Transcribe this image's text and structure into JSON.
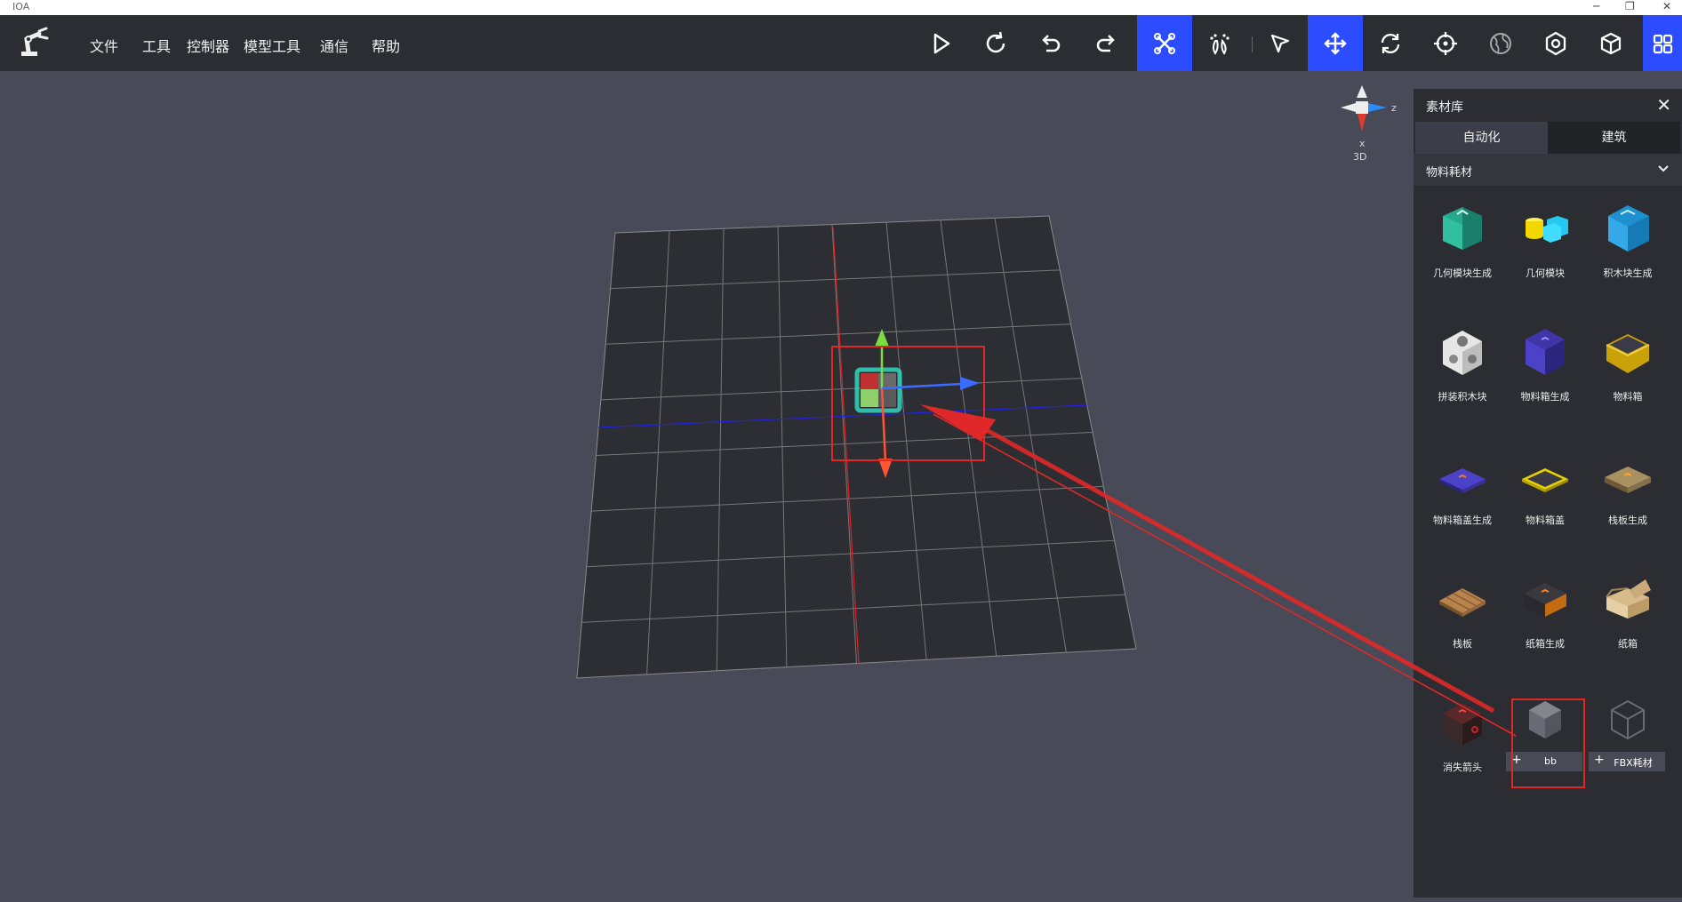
{
  "window": {
    "title": "IOA",
    "controls": [
      "─",
      "❐",
      "✕"
    ]
  },
  "menu": [
    "文件",
    "工具",
    "控制器",
    "模型工具",
    "通信",
    "帮助"
  ],
  "toolbar_icons": [
    "play-icon",
    "refresh-icon",
    "undo-icon",
    "redo-icon",
    "drone-icon",
    "footprint-icon",
    "select-arrow-icon",
    "move-icon",
    "rotate-icon",
    "target-icon",
    "globe-icon",
    "settings-icon",
    "box-icon",
    "grid-icon"
  ],
  "viewport": {
    "gizmo_labels": {
      "z": "z",
      "x": "x",
      "mode": "3D"
    }
  },
  "panel": {
    "title": "素材库",
    "close": "✕",
    "tabs": [
      "自动化",
      "建筑"
    ],
    "active_tab": "自动化",
    "category": "物料耗材",
    "items": [
      {
        "label": "几何模块生成",
        "icon": "teal-box-icon"
      },
      {
        "label": "几何模块",
        "icon": "yellow-cyan-shapes-icon"
      },
      {
        "label": "积木块生成",
        "icon": "blue-box-icon"
      },
      {
        "label": "拼装积木块",
        "icon": "white-block-icon"
      },
      {
        "label": "物料箱生成",
        "icon": "purple-box-icon"
      },
      {
        "label": "物料箱",
        "icon": "yellow-open-box-icon"
      },
      {
        "label": "物料箱盖生成",
        "icon": "purple-lid-icon"
      },
      {
        "label": "物料箱盖",
        "icon": "yellow-lid-icon"
      },
      {
        "label": "栈板生成",
        "icon": "tan-pallet-icon"
      },
      {
        "label": "栈板",
        "icon": "wood-pallet-icon"
      },
      {
        "label": "纸箱生成",
        "icon": "dark-carton-icon"
      },
      {
        "label": "纸箱",
        "icon": "open-carton-icon"
      },
      {
        "label": "消失箭头",
        "icon": "red-dark-cube-icon"
      }
    ],
    "add_buttons": [
      {
        "label": "bb",
        "plus": "+",
        "icon": "grey-cube-icon"
      },
      {
        "label": "FBX耗材",
        "plus": "+",
        "icon": "outline-cube-icon"
      }
    ]
  },
  "colors": {
    "accent": "#2c4dff",
    "annotation": "#e02828",
    "toolbar": "#2c2d32",
    "viewport": "#484a57"
  }
}
